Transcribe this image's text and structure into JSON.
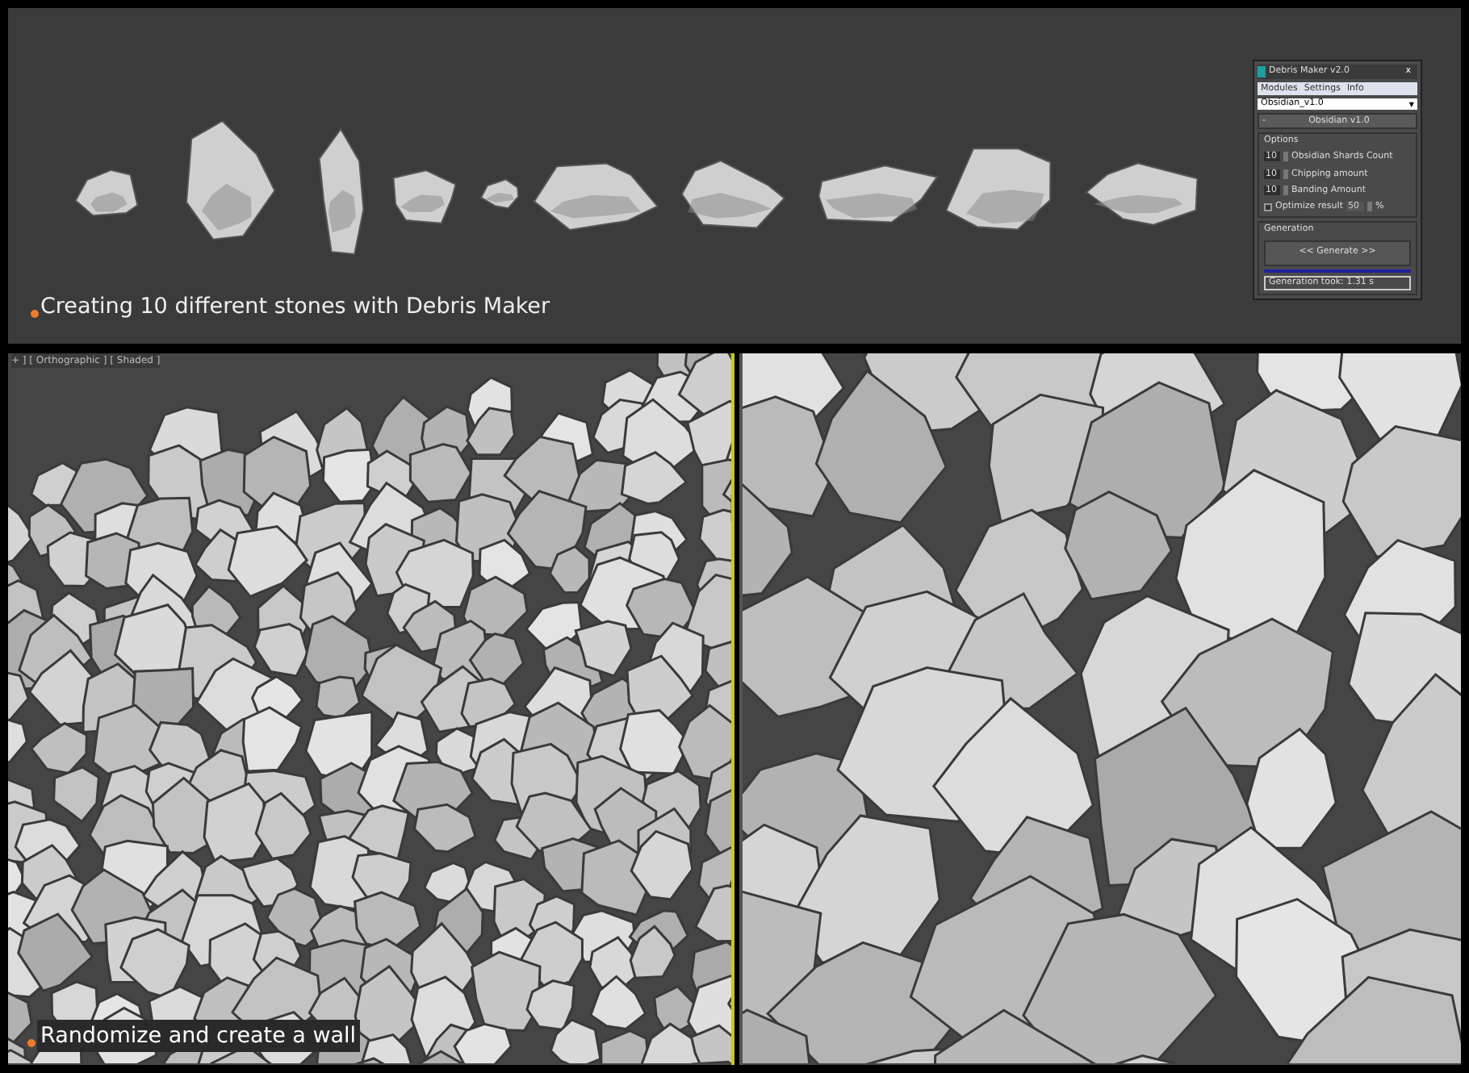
{
  "top_panel": {
    "caption": "Creating 10 different stones with Debris Maker"
  },
  "dialog": {
    "title": "Debris Maker v2.0",
    "close": "x",
    "menu": [
      "Modules",
      "Settings",
      "Info"
    ],
    "preset": "Obsidian_v1.0",
    "preset_caret": "▼",
    "rollout": {
      "toggle": "-",
      "title": "Obsidian v1.0"
    },
    "options": {
      "title": "Options",
      "spinners": [
        {
          "value": "10",
          "label": "Obsidian Shards Count"
        },
        {
          "value": "10",
          "label": "Chipping amount"
        },
        {
          "value": "10",
          "label": "Banding Amount"
        }
      ],
      "optimize": {
        "label": "Optimize result",
        "checked": false,
        "value": "50",
        "unit": "%"
      }
    },
    "generation": {
      "title": "Generation",
      "button": "<< Generate >>",
      "level": 1,
      "status": "Generation took: 1.31 s"
    }
  },
  "left_viewport": {
    "label": "+ ] [ Orthographic ] [ Shaded ]",
    "active": true,
    "caption": "Randomize and create a wall"
  },
  "right_viewport": {
    "active": false
  }
}
